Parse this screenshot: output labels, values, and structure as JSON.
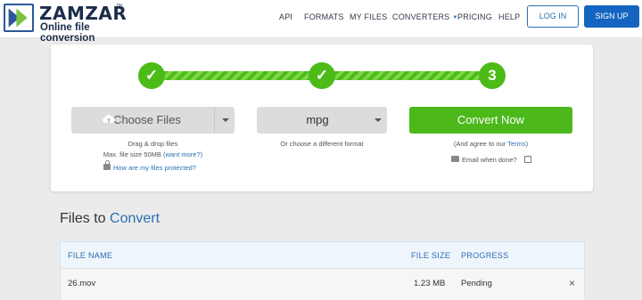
{
  "brand": {
    "name": "ZAMZAR",
    "registered": "™",
    "tagline": "Online file conversion",
    "color": "#1b2d4a"
  },
  "nav": {
    "items": [
      {
        "label": "API"
      },
      {
        "label": "FORMATS"
      },
      {
        "label": "MY FILES"
      },
      {
        "label": "CONVERTERS",
        "dropdown": true
      },
      {
        "label": "PRICING"
      },
      {
        "label": "HELP"
      }
    ],
    "login_label": "LOG IN",
    "signup_label": "SIGN UP"
  },
  "converter": {
    "steps": [
      {
        "state": "done",
        "display": "✓"
      },
      {
        "state": "done",
        "display": "✓"
      },
      {
        "state": "current",
        "display": "3"
      }
    ],
    "choose_files_label": "Choose Files",
    "drag_drop_text": "Drag & drop files",
    "max_size_text": "Max. file size 50MB",
    "want_more_link": "(want more?)",
    "protected_link": "How are my files protected?",
    "format_value": "mpg",
    "format_hint": "Or choose a different format",
    "convert_label": "Convert Now",
    "agree_prefix": "(And agree to our ",
    "terms_link": "Terms",
    "agree_suffix": ")",
    "email_label": "Email when done?",
    "email_checked": false
  },
  "files": {
    "heading_prefix": "Files to ",
    "heading_accent": "Convert",
    "columns": {
      "name": "FILE NAME",
      "size": "FILE SIZE",
      "progress": "PROGRESS"
    },
    "rows": [
      {
        "name": "26.mov",
        "size": "1.23 MB",
        "progress": "Pending",
        "remove": "×"
      }
    ]
  },
  "colors": {
    "accent_green": "#4cbb17",
    "link_blue": "#2b6fb3",
    "signup_blue": "#1565c0"
  }
}
